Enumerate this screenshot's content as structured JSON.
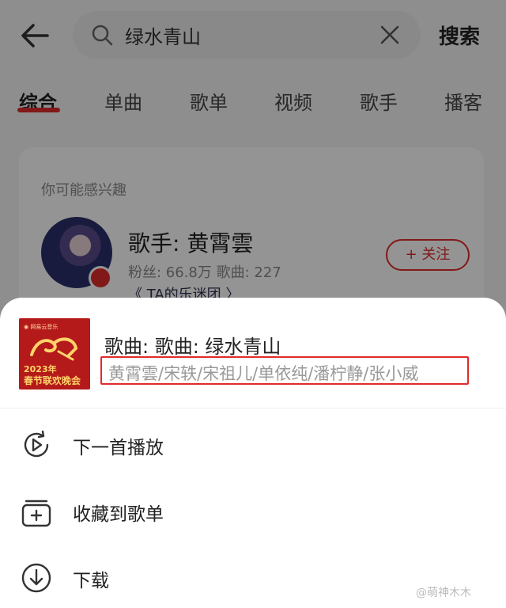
{
  "search": {
    "query": "绿水青山",
    "submit_label": "搜索"
  },
  "tabs": [
    {
      "label": "综合",
      "active": true
    },
    {
      "label": "单曲"
    },
    {
      "label": "歌单"
    },
    {
      "label": "视频"
    },
    {
      "label": "歌手"
    },
    {
      "label": "播客"
    }
  ],
  "recommend_card": {
    "title": "你可能感兴趣",
    "singer_name": "歌手: 黄霄雲",
    "stats": "粉丝: 66.8万 歌曲: 227",
    "fan_club": "《 TA的乐迷团 〉",
    "follow_label": "+ 关注"
  },
  "sheet": {
    "song_title": "歌曲: 歌曲:  绿水青山",
    "artists": "黄霄雲/宋轶/宋祖儿/单依纯/潘柠静/张小威",
    "cover": {
      "top_text": "◉ 网易云音乐",
      "year_text": "2023年",
      "caption": "春节联欢晚会"
    },
    "actions": [
      {
        "label": "下一首播放",
        "icon": "play-next-icon"
      },
      {
        "label": "收藏到歌单",
        "icon": "add-to-playlist-icon"
      },
      {
        "label": "下载",
        "icon": "download-icon"
      }
    ]
  },
  "watermark": "@萌神木木",
  "colors": {
    "accent": "#e02b2b",
    "overlay": "rgba(0,0,0,0.42)"
  }
}
